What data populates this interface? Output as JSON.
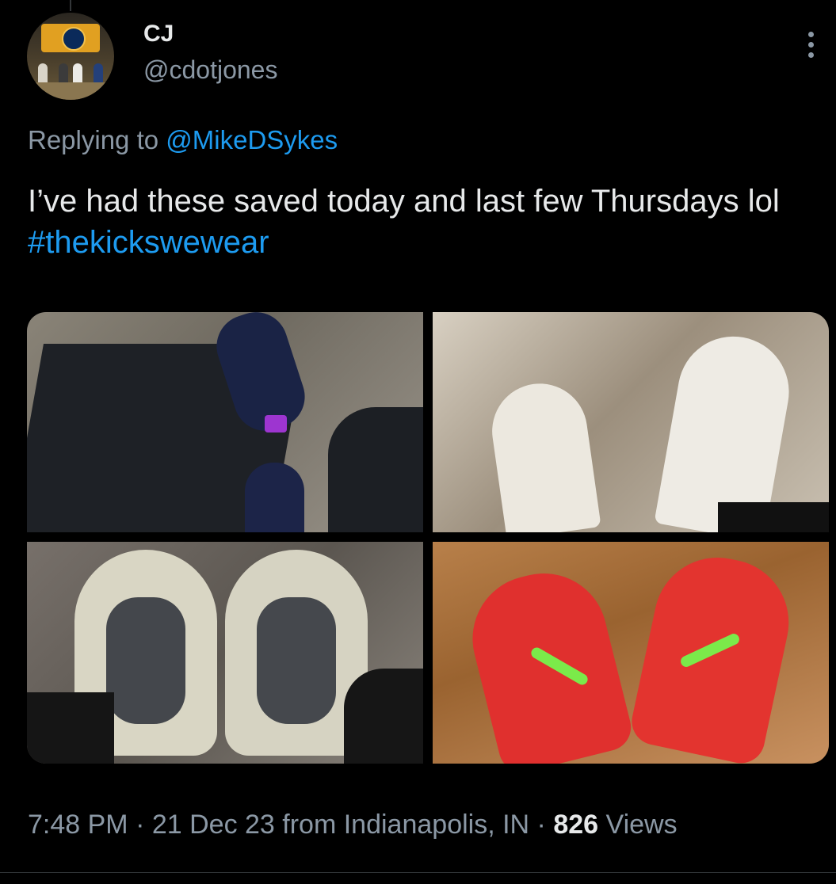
{
  "author": {
    "name": "CJ",
    "handle": "@cdotjones"
  },
  "reply": {
    "prefix": "Replying to",
    "mention": "@MikeDSykes"
  },
  "tweet": {
    "text": "I’ve had these saved today and last few Thursdays lol ",
    "hashtag": "#thekickswewear"
  },
  "meta": {
    "time": "7:48 PM",
    "sep1": " · ",
    "date": "21 Dec 23",
    "source": " from Indianapolis, IN",
    "sep2": " · ",
    "views_count": "826",
    "views_label": " Views"
  },
  "colors": {
    "background": "#000000",
    "text": "#e7e9ea",
    "secondary": "#8b98a5",
    "link": "#1d9bf0"
  },
  "icons": {
    "more": "more-vertical-icon"
  }
}
